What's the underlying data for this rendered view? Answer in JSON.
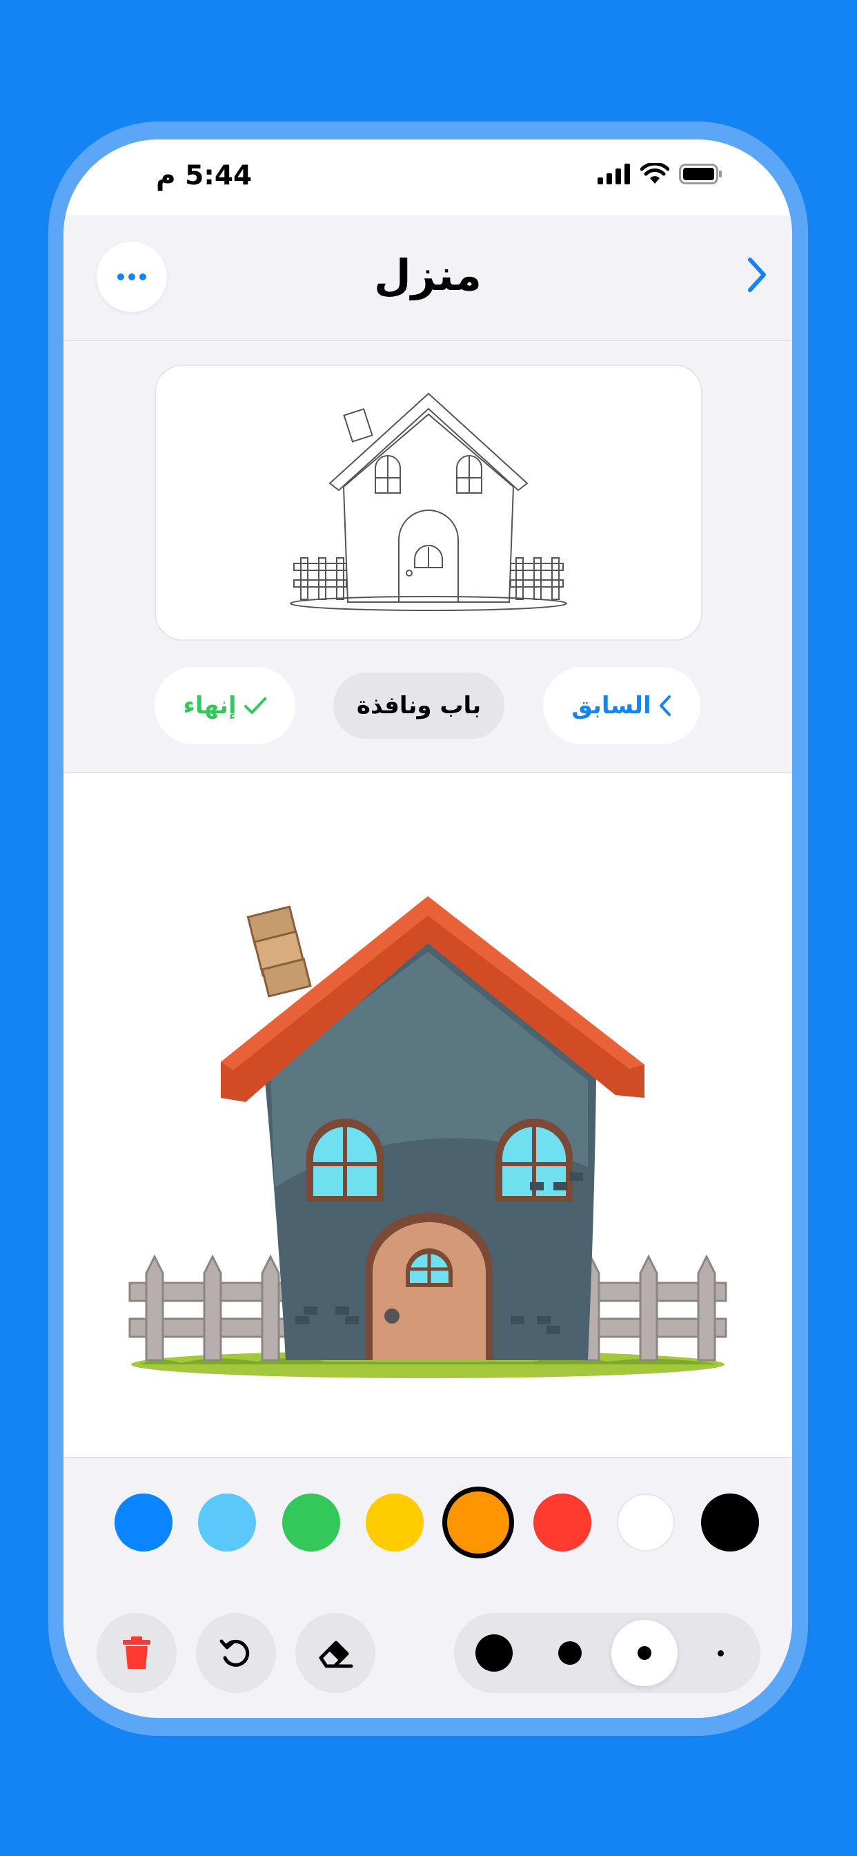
{
  "status_bar": {
    "time": "5:44 م"
  },
  "header": {
    "title": "منزل"
  },
  "controls": {
    "previous_label": "السابق",
    "step_label": "باب ونافذة",
    "finish_label": "إنهاء"
  },
  "palette": {
    "colors": [
      "#0A84FF",
      "#5AC8FA",
      "#34C759",
      "#FFCC00",
      "#FF9500",
      "#FF3B30",
      "#FFFFFF",
      "#000000"
    ],
    "selected": "#FF9500"
  },
  "tools": {
    "delete_icon": "trash-icon",
    "undo_icon": "undo-icon",
    "eraser_icon": "eraser-icon",
    "brush_sizes": [
      "extra-large",
      "large",
      "medium",
      "small"
    ],
    "selected_brush": "medium"
  },
  "accent": "#1483F3"
}
